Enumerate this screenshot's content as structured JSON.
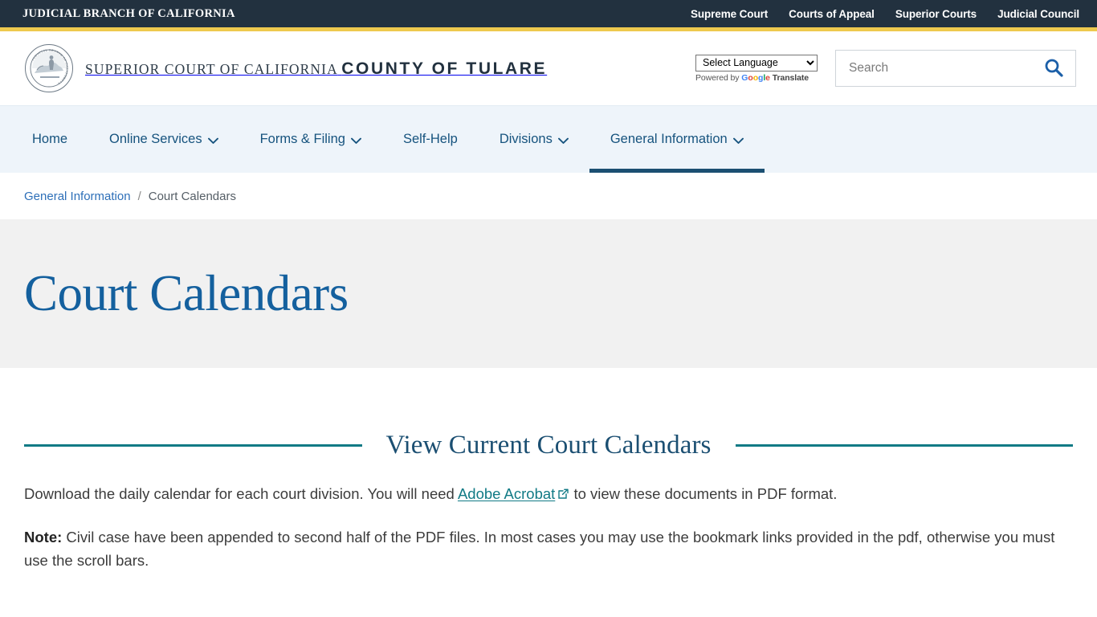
{
  "topbar": {
    "brand": "JUDICIAL BRANCH OF CALIFORNIA",
    "links": [
      {
        "label": "Supreme Court"
      },
      {
        "label": "Courts of Appeal"
      },
      {
        "label": "Superior Courts"
      },
      {
        "label": "Judicial Council"
      }
    ],
    "background": "#22313f",
    "accent_bar": "#eec94e"
  },
  "masthead": {
    "seal_icon": "california-judicial-seal-icon",
    "seal_text": "JUDICIAL BRANCH OF CALIFORNIA",
    "court_line1": "SUPERIOR COURT OF CALIFORNIA",
    "court_line2": "COUNTY OF TULARE",
    "translate": {
      "selected": "Select Language",
      "options": [
        "Select Language"
      ],
      "powered_prefix": "Powered by",
      "google_letters": [
        "G",
        "o",
        "o",
        "g",
        "l",
        "e"
      ],
      "translate_label": "Translate"
    },
    "search": {
      "placeholder": "Search",
      "value": "",
      "icon": "search-icon",
      "icon_color": "#1b5fa8"
    }
  },
  "mainnav": {
    "background": "#eef4fa",
    "active_underline": "#1b4f72",
    "items": [
      {
        "label": "Home",
        "has_chevron": false,
        "active": false
      },
      {
        "label": "Online Services",
        "has_chevron": true,
        "active": false
      },
      {
        "label": "Forms & Filing",
        "has_chevron": true,
        "active": false
      },
      {
        "label": "Self-Help",
        "has_chevron": false,
        "active": false
      },
      {
        "label": "Divisions",
        "has_chevron": true,
        "active": false
      },
      {
        "label": "General Information",
        "has_chevron": true,
        "active": true
      }
    ]
  },
  "breadcrumb": {
    "parent": "General Information",
    "separator": "/",
    "current": "Court Calendars"
  },
  "hero": {
    "title": "Court Calendars",
    "background": "#f1f1f1",
    "title_color": "#14609e"
  },
  "main": {
    "section_heading": "View Current Court Calendars",
    "rule_color": "#117a85",
    "paragraph1": {
      "before_link": "Download the daily calendar for each court division. You will need ",
      "link_text": "Adobe Acrobat",
      "link_icon": "external-link-icon",
      "after_link": " to view these documents in PDF format."
    },
    "paragraph2": {
      "label": "Note:",
      "text": " Civil case have been appended to second half of the PDF files. In most cases you may use the bookmark links provided in the pdf, otherwise you must use the scroll bars."
    }
  }
}
